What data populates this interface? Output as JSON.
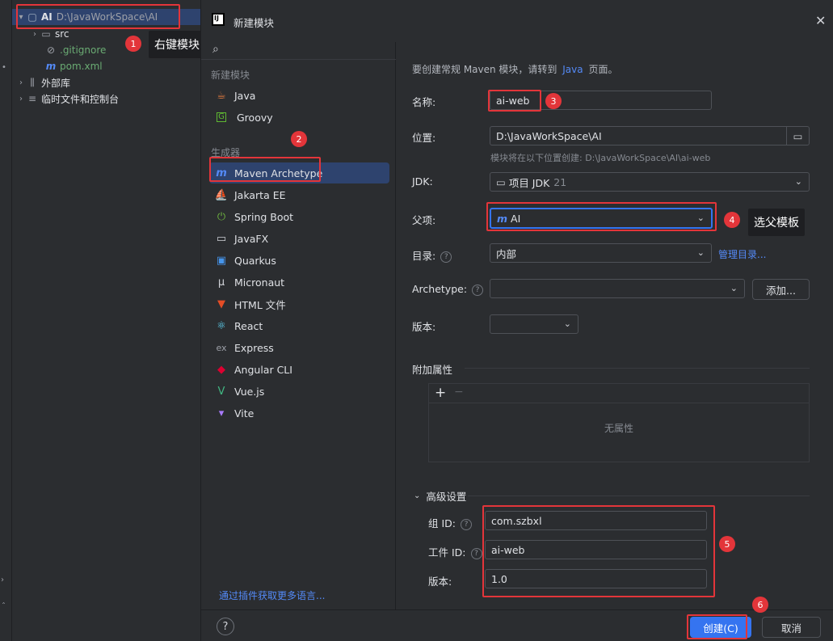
{
  "tree": {
    "root_name": "AI",
    "root_path": "D:\\JavaWorkSpace\\AI",
    "items": [
      {
        "label": "src"
      },
      {
        "label": ".gitignore"
      },
      {
        "label": "pom.xml"
      },
      {
        "label": "外部库"
      },
      {
        "label": "临时文件和控制台"
      }
    ]
  },
  "dialog": {
    "app_icon": "IJ",
    "title": "新建模块",
    "search_placeholder": "",
    "sections": {
      "new_module": "新建模块",
      "generators": "生成器"
    },
    "new_items": [
      {
        "label": "Java",
        "icon": "java-icon"
      },
      {
        "label": "Groovy",
        "icon": "groovy-icon"
      }
    ],
    "generator_items": [
      {
        "label": "Maven Archetype",
        "icon": "maven-icon"
      },
      {
        "label": "Jakarta EE",
        "icon": "jakarta-icon"
      },
      {
        "label": "Spring Boot",
        "icon": "spring-icon"
      },
      {
        "label": "JavaFX",
        "icon": "javafx-icon"
      },
      {
        "label": "Quarkus",
        "icon": "quarkus-icon"
      },
      {
        "label": "Micronaut",
        "icon": "micronaut-icon"
      },
      {
        "label": "HTML 文件",
        "icon": "html-icon"
      },
      {
        "label": "React",
        "icon": "react-icon"
      },
      {
        "label": "Express",
        "icon": "express-icon"
      },
      {
        "label": "Angular CLI",
        "icon": "angular-icon"
      },
      {
        "label": "Vue.js",
        "icon": "vue-icon"
      },
      {
        "label": "Vite",
        "icon": "vite-icon"
      }
    ],
    "plugins_link": "通过插件获取更多语言..."
  },
  "form": {
    "hint_prefix": "要创建常规 Maven 模块，请转到",
    "hint_link": "Java",
    "hint_suffix": "页面。",
    "name_label": "名称:",
    "name_value": "ai-web",
    "location_label": "位置:",
    "location_value": "D:\\JavaWorkSpace\\AI",
    "location_hint": "模块将在以下位置创建: D:\\JavaWorkSpace\\AI\\ai-web",
    "jdk_label": "JDK:",
    "jdk_value": "项目 JDK",
    "jdk_version": "21",
    "parent_label": "父项:",
    "parent_value": "AI",
    "catalog_label": "目录:",
    "catalog_value": "内部",
    "catalog_manage": "管理目录...",
    "archetype_label": "Archetype:",
    "archetype_value": "",
    "add_button": "添加...",
    "version_label": "版本:",
    "version_value": "",
    "props_label": "附加属性",
    "props_add": "+",
    "props_remove": "−",
    "props_empty": "无属性",
    "advanced_label": "高级设置",
    "group_label": "组 ID:",
    "group_value": "com.szbxl",
    "artifact_label": "工件 ID:",
    "artifact_value": "ai-web",
    "adv_version_label": "版本:",
    "adv_version_value": "1.0"
  },
  "footer": {
    "help": "?",
    "create": "创建(C)",
    "cancel": "取消"
  },
  "annotations": [
    {
      "num": "1",
      "text": "右键模块"
    },
    {
      "num": "2"
    },
    {
      "num": "3"
    },
    {
      "num": "4",
      "text": "选父模板"
    },
    {
      "num": "5"
    },
    {
      "num": "6"
    }
  ],
  "colors": {
    "accent": "#548af7",
    "selection": "#2e436e",
    "annotation_red": "#e3353a",
    "primary_button": "#3574f0"
  }
}
